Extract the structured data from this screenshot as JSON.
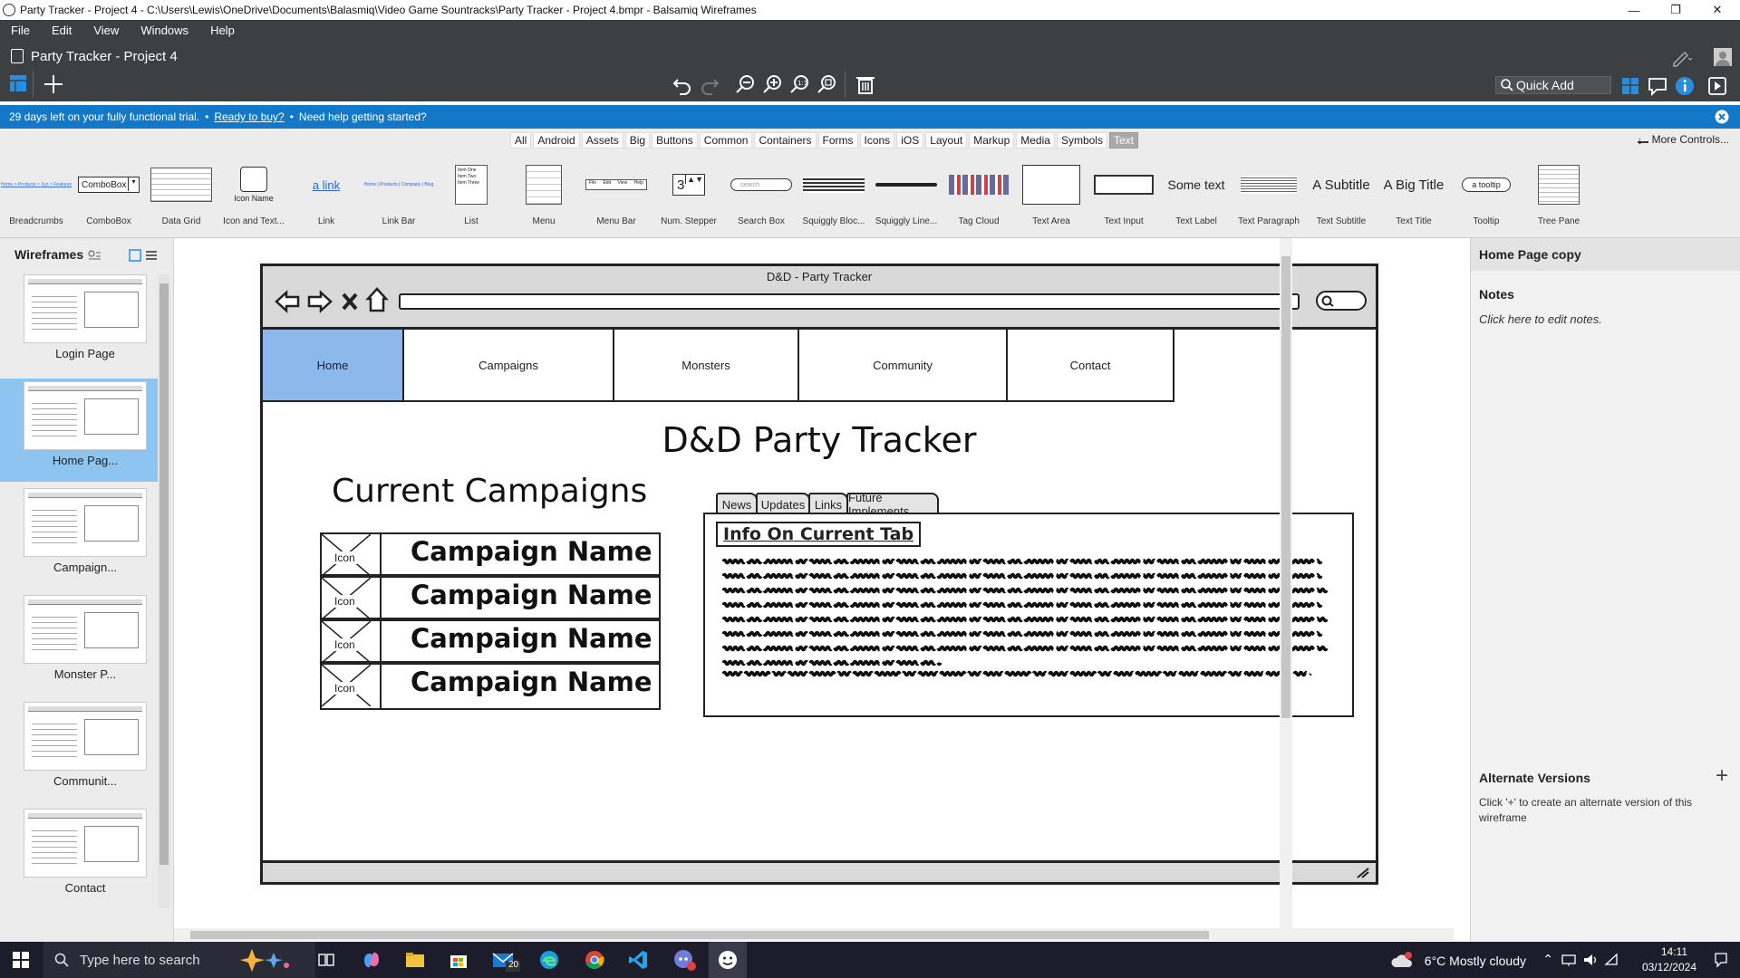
{
  "window": {
    "title": "Party Tracker - Project 4 - C:\\Users\\Lewis\\OneDrive\\Documents\\Balasmiq\\Video Game Sountracks\\Party Tracker - Project 4.bmpr - Balsamiq Wireframes",
    "controls": [
      "—",
      "❐",
      "✕"
    ]
  },
  "menu": [
    "File",
    "Edit",
    "View",
    "Windows",
    "Help"
  ],
  "header": {
    "project_title": "Party Tracker - Project 4",
    "quick_add": "Quick Add"
  },
  "trial": {
    "days_text": "29 days left on your fully functional trial.",
    "buy_link": "Ready to buy?",
    "help_text": "Need help getting started?"
  },
  "library": {
    "tabs": [
      "All",
      "Android",
      "Assets",
      "Big",
      "Buttons",
      "Common",
      "Containers",
      "Forms",
      "Icons",
      "iOS",
      "Layout",
      "Markup",
      "Media",
      "Symbols",
      "Text"
    ],
    "selected_tab": "Text",
    "more_controls": "More Controls...",
    "items": [
      {
        "label": "Breadcrumbs",
        "preview": "Home > Products > Xyz > Features"
      },
      {
        "label": "ComboBox",
        "preview": "ComboBox"
      },
      {
        "label": "Data Grid",
        "preview": ""
      },
      {
        "label": "Icon and Text...",
        "preview": "Icon Name"
      },
      {
        "label": "Link",
        "preview": "a link"
      },
      {
        "label": "Link Bar",
        "preview": "Home | Products | Company | Blog"
      },
      {
        "label": "List",
        "preview": "Item One Item Two Item Three"
      },
      {
        "label": "Menu",
        "preview": ""
      },
      {
        "label": "Menu Bar",
        "preview": "File Edit View Help"
      },
      {
        "label": "Num. Stepper",
        "preview": "3"
      },
      {
        "label": "Search Box",
        "preview": "search"
      },
      {
        "label": "Squiggly Bloc...",
        "preview": ""
      },
      {
        "label": "Squiggly Line...",
        "preview": ""
      },
      {
        "label": "Tag Cloud",
        "preview": ""
      },
      {
        "label": "Text Area",
        "preview": ""
      },
      {
        "label": "Text Input",
        "preview": ""
      },
      {
        "label": "Text Label",
        "preview": "Some text"
      },
      {
        "label": "Text Paragraph",
        "preview": ""
      },
      {
        "label": "Text Subtitle",
        "preview": "A Subtitle"
      },
      {
        "label": "Text Title",
        "preview": "A Big Title"
      },
      {
        "label": "Tooltip",
        "preview": "a tooltip"
      },
      {
        "label": "Tree Pane",
        "preview": ""
      }
    ]
  },
  "sidebar": {
    "title": "Wireframes",
    "pages": [
      "Login Page",
      "Home Pag...",
      "Campaign...",
      "Monster P...",
      "Communit...",
      "Contact"
    ],
    "selected": 1
  },
  "mockup": {
    "browser_title": "D&D - Party Tracker",
    "nav": [
      "Home",
      "Campaigns",
      "Monsters",
      "Community",
      "Contact"
    ],
    "nav_selected": "Home",
    "heading": "D&D Party Tracker",
    "campaigns_heading": "Current Campaigns",
    "campaigns": [
      {
        "icon": "Icon",
        "name": "Campaign Name"
      },
      {
        "icon": "Icon",
        "name": "Campaign Name"
      },
      {
        "icon": "Icon",
        "name": "Campaign Name"
      },
      {
        "icon": "Icon",
        "name": "Campaign Name"
      }
    ],
    "tabs": [
      "News",
      "Updates",
      "Links",
      "Future Implements"
    ],
    "tab_title": "Info On Current Tab"
  },
  "properties": {
    "page_name": "Home Page copy",
    "notes_title": "Notes",
    "notes_placeholder": "Click here to edit notes.",
    "alt_title": "Alternate Versions",
    "alt_text": "Click '+' to create an alternate version of this wireframe"
  },
  "taskbar": {
    "search_placeholder": "Type here to search",
    "mail_badge": "20",
    "weather": "6°C  Mostly cloudy",
    "time": "14:11",
    "date": "03/12/2024"
  },
  "colors": {
    "app_dark": "#3c4043",
    "trial_blue": "#1478c8",
    "selection_blue": "#8db8ec"
  }
}
